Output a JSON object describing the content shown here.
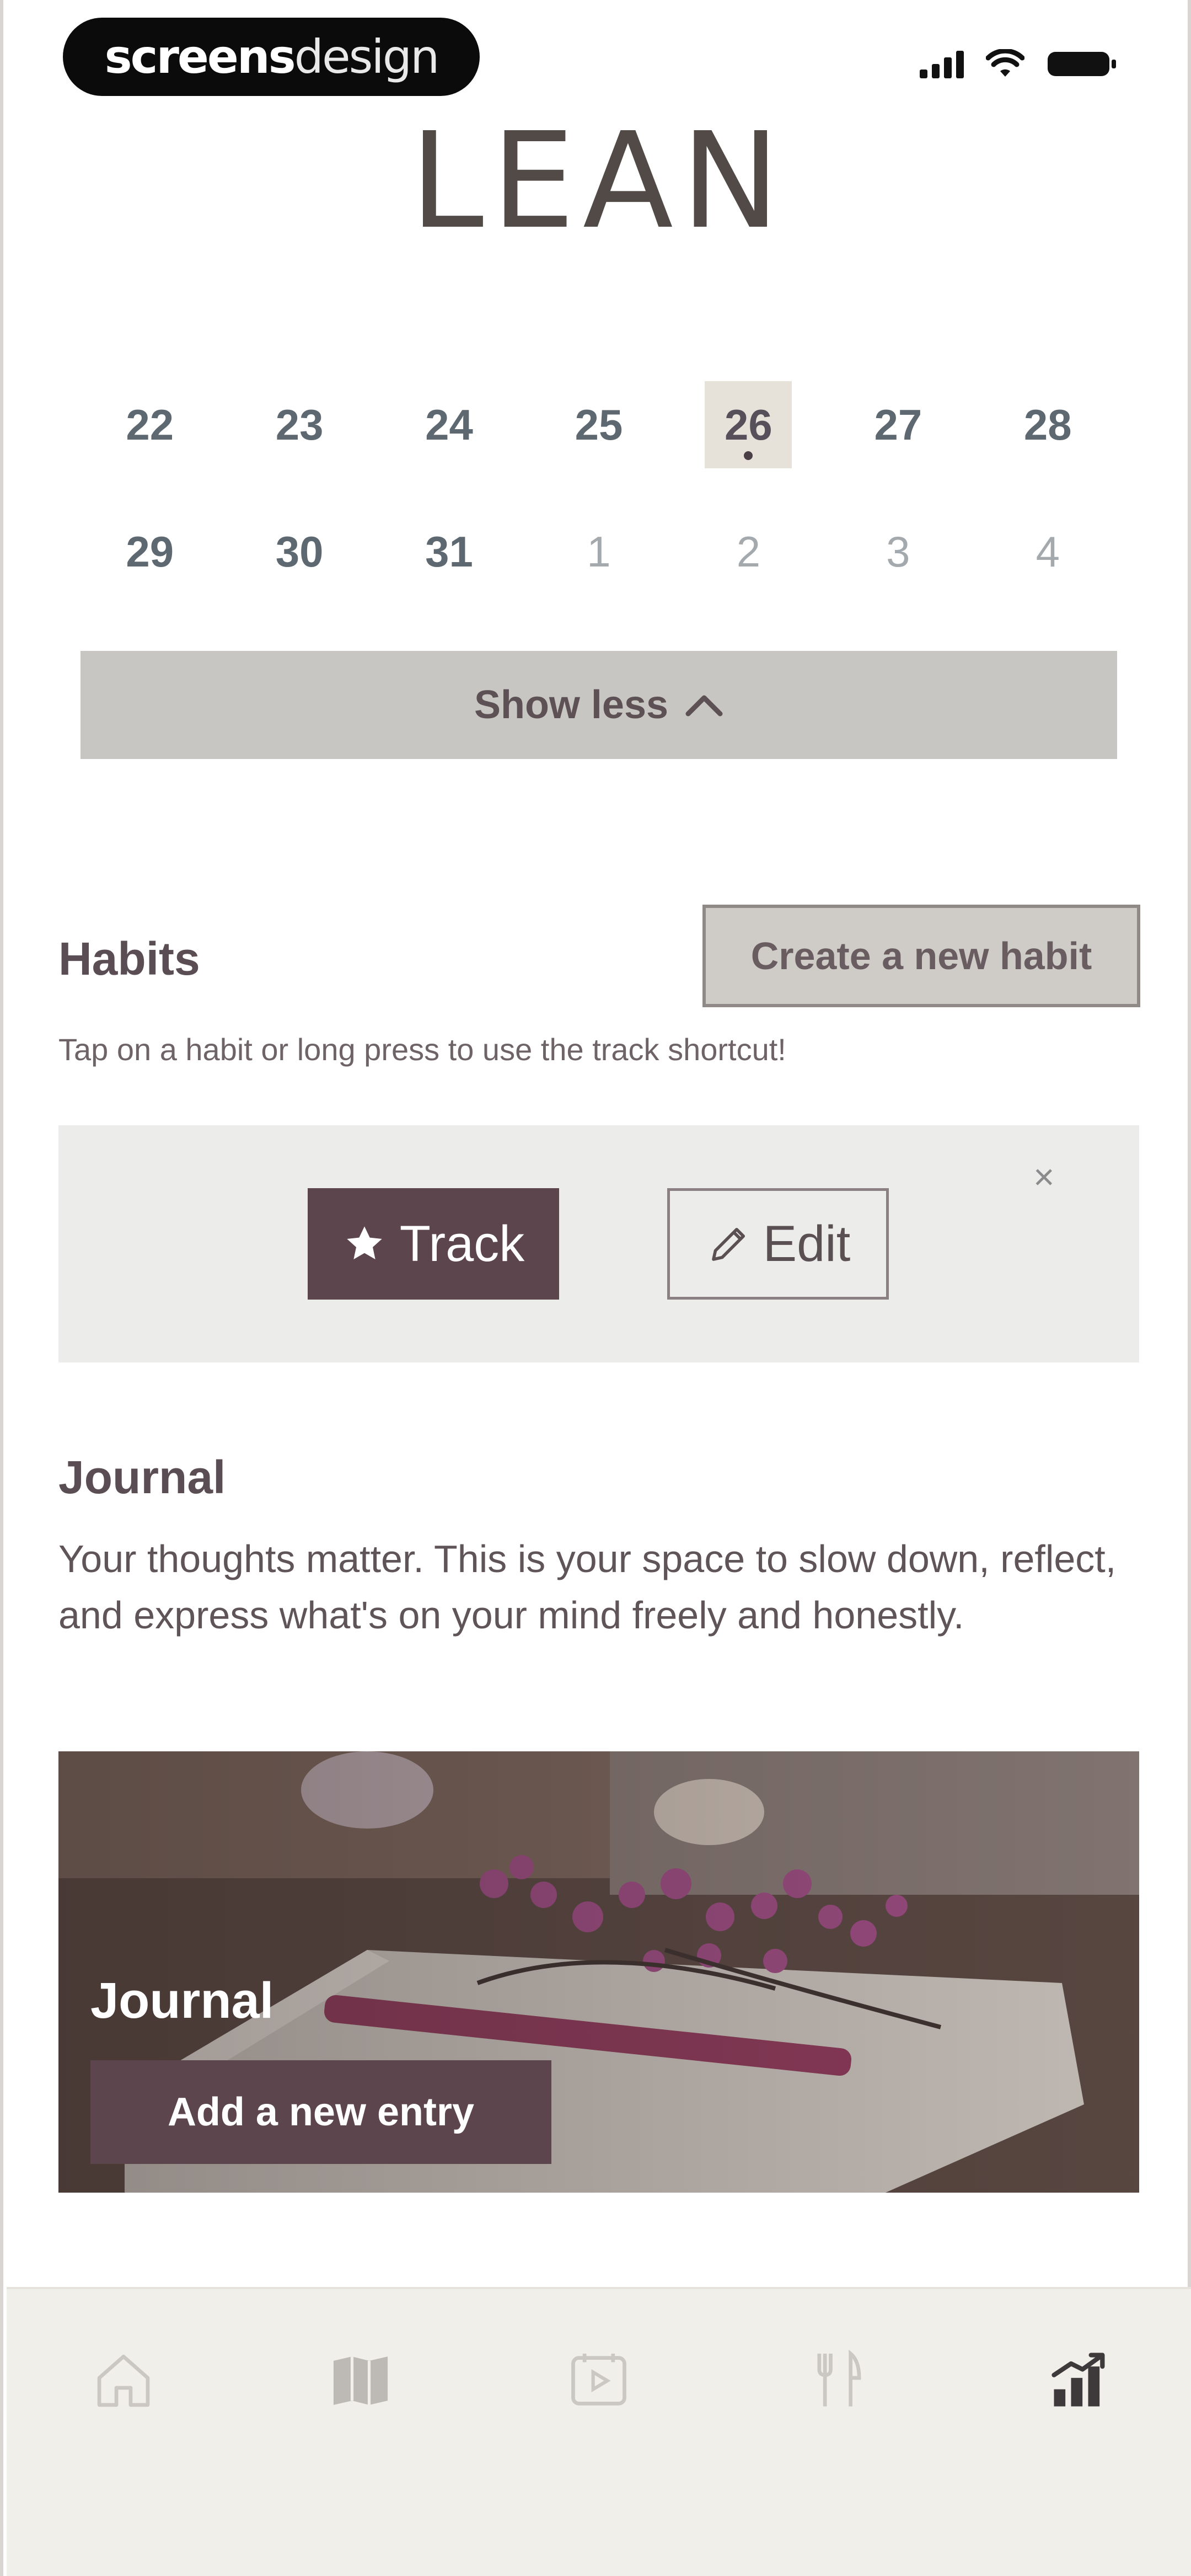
{
  "status_bar": {
    "badge_part1": "screens",
    "badge_part2": "design"
  },
  "app": {
    "logo": "LEAN"
  },
  "calendar": {
    "week1": [
      {
        "label": "22",
        "muted": false
      },
      {
        "label": "23",
        "muted": false
      },
      {
        "label": "24",
        "muted": false
      },
      {
        "label": "25",
        "muted": false
      },
      {
        "label": "26",
        "muted": false,
        "selected": true
      },
      {
        "label": "27",
        "muted": false
      },
      {
        "label": "28",
        "muted": false
      }
    ],
    "week2": [
      {
        "label": "29",
        "muted": false
      },
      {
        "label": "30",
        "muted": false
      },
      {
        "label": "31",
        "muted": false
      },
      {
        "label": "1",
        "muted": true
      },
      {
        "label": "2",
        "muted": true
      },
      {
        "label": "3",
        "muted": true
      },
      {
        "label": "4",
        "muted": true
      }
    ],
    "show_less_label": "Show less"
  },
  "habits": {
    "title": "Habits",
    "create_label": "Create a new habit",
    "subtitle": "Tap on a habit or long press to use the track shortcut!",
    "track_label": "Track",
    "edit_label": "Edit",
    "close_glyph": "×"
  },
  "journal": {
    "title": "Journal",
    "description": "Your thoughts matter. This is your space to slow down, reflect, and express what's on your mind freely and honestly.",
    "card_title": "Journal",
    "add_entry_label": "Add a new entry"
  },
  "tabs": {
    "items": [
      "home-icon",
      "book-icon",
      "play-video-icon",
      "fork-knife-icon",
      "stats-icon"
    ],
    "active": "stats-icon"
  },
  "colors": {
    "accent": "#5d454d",
    "selected_day_bg": "#e6e2da",
    "tabbar_bg": "#f1efea"
  }
}
